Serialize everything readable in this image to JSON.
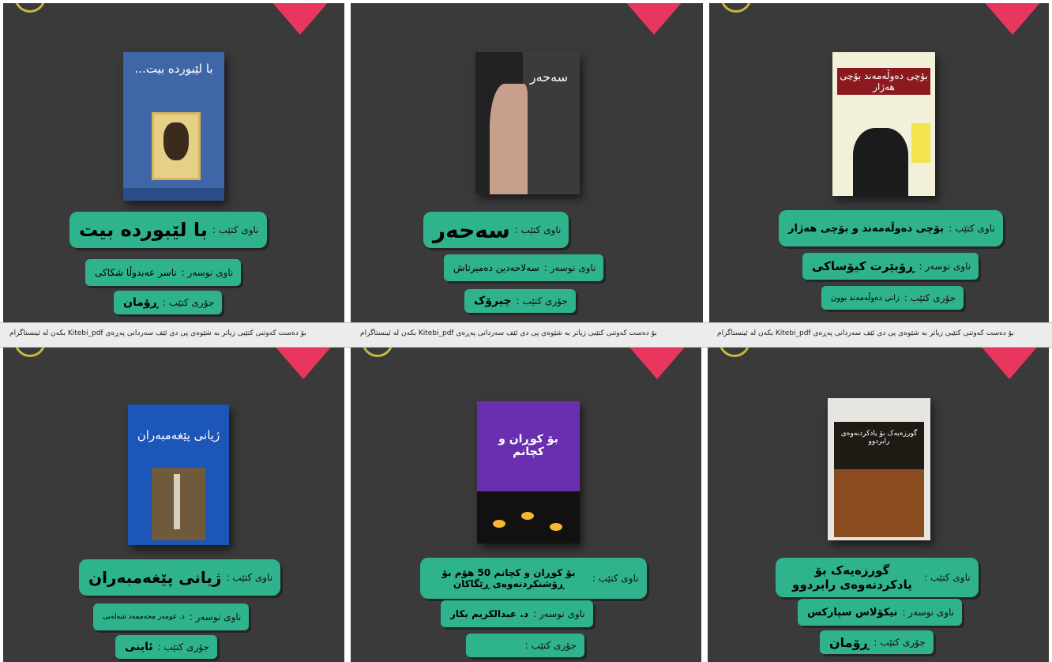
{
  "field_labels": {
    "book_name": "ناوی کتێب :",
    "author": "ناوی نوسەر :",
    "genre": "جۆری کتێب :"
  },
  "footer_text": "بۆ دەست کەوتنی کتێبی زیاتر بە شێوەی پی دی ئێف سەردانی پەڕەی Kitebi_pdf بکەن لە ئینستاگرام",
  "books": [
    {
      "title": "با لێبوردە بیت",
      "author": "ناسر عەبدوڵا شکاکی",
      "genre": "ڕۆمان",
      "cover_text": "با لێبوردە بیت...",
      "cover_color": "#3f67a8"
    },
    {
      "title": "سەحەر",
      "author": "سەلاحەدین دەمیرتاش",
      "genre": "چیرۆک",
      "cover_text": "سەحەر",
      "cover_color": "#3c3a3a"
    },
    {
      "title": "بۆچی دەوڵەمەند و بۆچی هەژار",
      "author": "ڕۆبێرت کیۆساکی",
      "genre": "زانی دەوڵەمەند بوون",
      "cover_text": "بۆچی دەوڵەمەند بۆچی هەژار",
      "cover_color": "#f2f0d8"
    },
    {
      "title": "ژیانی پێغەمبەران",
      "author": "د. عومەر محەممەد شەلەبی",
      "genre": "ئاینی",
      "cover_text": "ژیانی پێغەمبەران",
      "cover_color": "#1c56b8"
    },
    {
      "title": "بۆ کوڕان و کچانم 50 هۆم بۆ ڕۆشنکردنەوەی ڕێگاکان",
      "author": "د. عبدالكريم بكار",
      "genre": "",
      "cover_text": "بۆ کوڕان و کچانم",
      "cover_color": "#6a2fb0"
    },
    {
      "title": "گورزەیەک بۆ یادکردنەوەی رابردوو",
      "author": "نیکۆلاس سپارکس",
      "genre": "ڕۆمان",
      "cover_text": "گورزەیەک بۆ یادکردنەوەی رابردوو",
      "cover_color": "#1e1a14"
    }
  ]
}
